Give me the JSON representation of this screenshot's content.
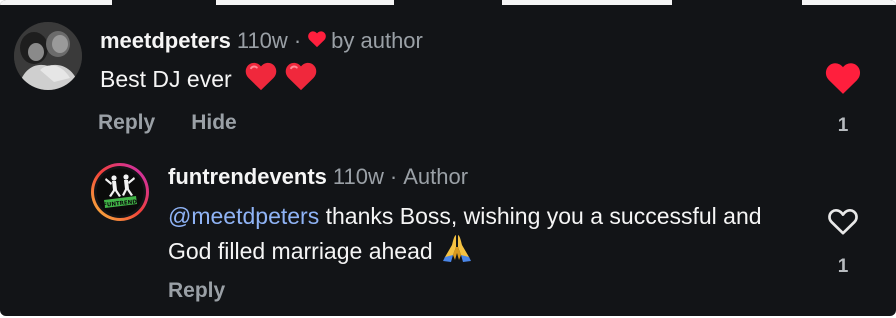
{
  "colors": {
    "background": "#121417",
    "text_primary": "#f5f5f5",
    "text_muted": "#9aa0a6",
    "mention": "#8fb3f5",
    "like_active": "#ff1f3d"
  },
  "comments": [
    {
      "username": "meetdpeters",
      "age": "110w",
      "separator": "·",
      "author_badge_icon": "heart-icon",
      "author_badge_text": "by author",
      "text": "Best DJ ever",
      "emoji_icons": [
        "red-heart-emoji-icon",
        "red-heart-emoji-icon"
      ],
      "actions": {
        "reply": "Reply",
        "hide": "Hide"
      },
      "liked": true,
      "like_count": "1"
    },
    {
      "username": "funtrendevents",
      "age": "110w",
      "separator": "·",
      "role": "Author",
      "mention": "@meetdpeters",
      "text": " thanks Boss, wishing you a successful and God filled marriage ahead",
      "emoji_icons": [
        "folded-hands-emoji-icon"
      ],
      "actions": {
        "reply": "Reply"
      },
      "liked": false,
      "like_count": "1"
    }
  ]
}
